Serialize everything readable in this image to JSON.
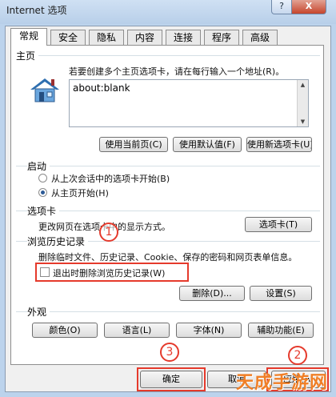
{
  "window": {
    "title": "Internet 选项",
    "help_label": "?",
    "close_label": "X"
  },
  "tabs": [
    {
      "label": "常规"
    },
    {
      "label": "安全"
    },
    {
      "label": "隐私"
    },
    {
      "label": "内容"
    },
    {
      "label": "连接"
    },
    {
      "label": "程序"
    },
    {
      "label": "高级"
    }
  ],
  "homepage": {
    "group_title": "主页",
    "description": "若要创建多个主页选项卡，请在每行输入一个地址(R)。",
    "value": "about:blank",
    "buttons": {
      "use_current": "使用当前页(C)",
      "use_default": "使用默认值(F)",
      "use_new_tab": "使用新选项卡(U)"
    }
  },
  "startup": {
    "group_title": "启动",
    "options": [
      {
        "label": "从上次会话中的选项卡开始(B)",
        "selected": false
      },
      {
        "label": "从主页开始(H)",
        "selected": true
      }
    ]
  },
  "tabs_section": {
    "group_title": "选项卡",
    "description": "更改网页在选项卡中的显示方式。",
    "button": "选项卡(T)"
  },
  "history": {
    "group_title": "浏览历史记录",
    "description": "删除临时文件、历史记录、Cookie、保存的密码和网页表单信息。",
    "checkbox_label": "退出时删除浏览历史记录(W)",
    "checkbox_checked": false,
    "delete_button": "删除(D)...",
    "settings_button": "设置(S)"
  },
  "appearance": {
    "group_title": "外观",
    "buttons": [
      "颜色(O)",
      "语言(L)",
      "字体(N)",
      "辅助功能(E)"
    ]
  },
  "footer": {
    "ok": "确定",
    "cancel": "取消",
    "apply": "应用(A)"
  },
  "annotations": {
    "badge1": "1",
    "badge2": "2",
    "badge3": "3",
    "highlight_color": "#e53a2c"
  },
  "watermark": "天成手游网"
}
